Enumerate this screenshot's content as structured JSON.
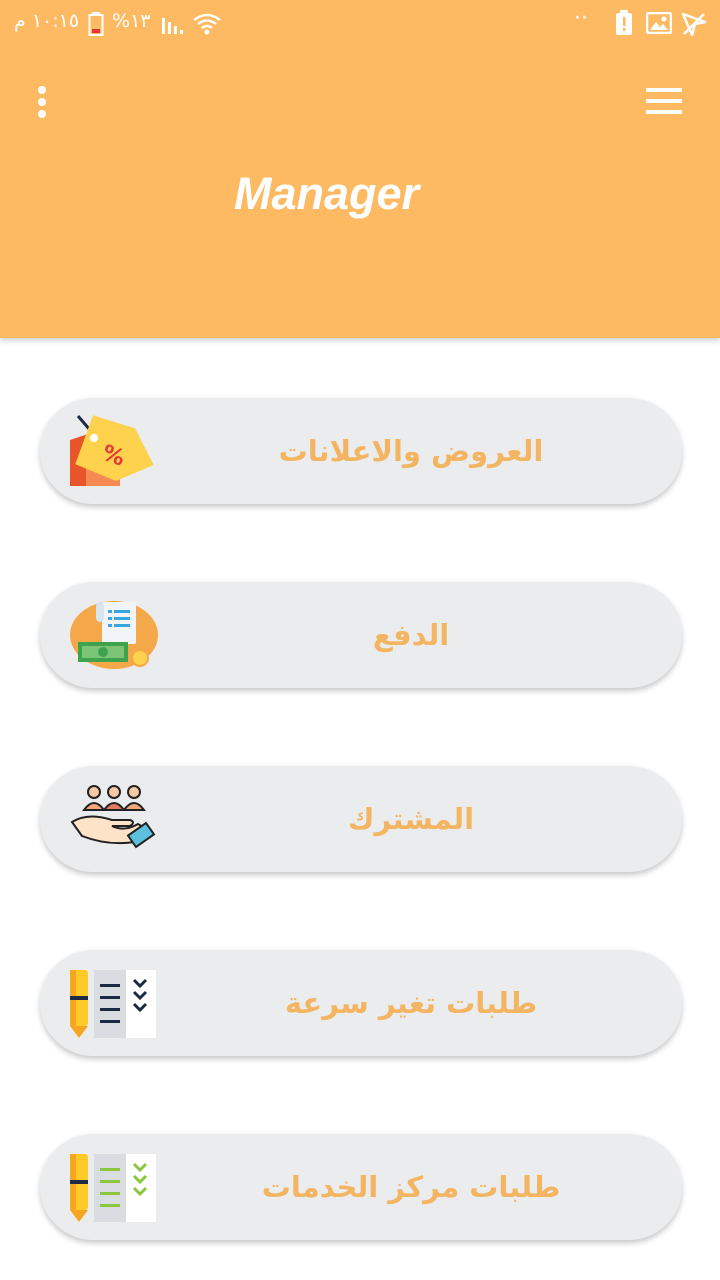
{
  "status_bar": {
    "time": "١٠:١٥ م",
    "battery_percent": "%١٣",
    "signal_icon": "signal-icon",
    "wifi_icon": "wifi-icon",
    "battery_icon": "battery-icon",
    "notification_dots": "··"
  },
  "app_bar": {
    "title": "Manager",
    "overflow_icon": "more-vertical-icon",
    "menu_icon": "hamburger-menu-icon"
  },
  "menu": {
    "items": [
      {
        "label": "العروض والاعلانات",
        "icon": "discount-tag-icon"
      },
      {
        "label": "الدفع",
        "icon": "payment-bill-icon"
      },
      {
        "label": "المشترك",
        "icon": "subscribers-hand-icon"
      },
      {
        "label": "طلبات تغير سرعة",
        "icon": "checklist-pencil-icon"
      },
      {
        "label": "طلبات مركز الخدمات",
        "icon": "checklist-pencil-green-icon"
      }
    ]
  },
  "colors": {
    "header": "#FDBA62",
    "button_bg": "#EBECEE",
    "label_text": "#F3B562"
  }
}
